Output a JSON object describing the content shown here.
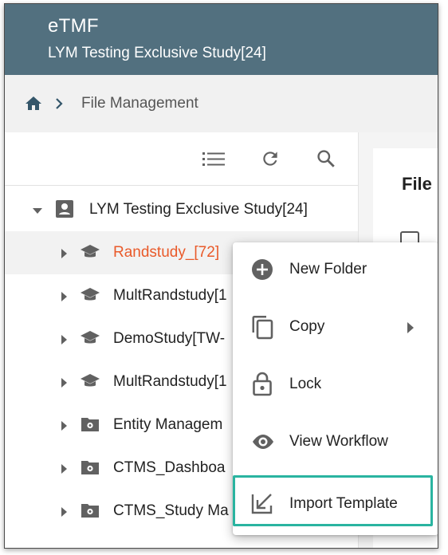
{
  "header": {
    "app_title": "eTMF",
    "study_name": "LYM Testing Exclusive Study[24]"
  },
  "breadcrumb": {
    "current": "File Management"
  },
  "tree": {
    "root": "LYM Testing Exclusive Study[24]",
    "items": [
      {
        "label": "Randstudy_[72]",
        "icon": "graduation-cap-icon",
        "state": "active"
      },
      {
        "label": "MultRandstudy[1",
        "icon": "graduation-cap-icon"
      },
      {
        "label": "DemoStudy[TW-",
        "icon": "graduation-cap-icon"
      },
      {
        "label": "MultRandstudy[1",
        "icon": "graduation-cap-icon"
      },
      {
        "label": "Entity Managem",
        "icon": "gear-folder-icon"
      },
      {
        "label": "CTMS_Dashboa",
        "icon": "gear-folder-icon"
      },
      {
        "label": "CTMS_Study Ma",
        "icon": "gear-folder-icon"
      }
    ]
  },
  "right_panel": {
    "heading": "File"
  },
  "context_menu": {
    "items": [
      {
        "label": "New Folder",
        "icon": "add-circle-icon"
      },
      {
        "label": "Copy",
        "icon": "copy-icon",
        "has_submenu": true
      },
      {
        "label": "Lock",
        "icon": "lock-icon"
      },
      {
        "label": "View Workflow",
        "icon": "eye-icon"
      },
      {
        "label": "Import Template",
        "icon": "import-icon",
        "highlighted": true
      }
    ]
  },
  "colors": {
    "header_bg": "#52707f",
    "active_text": "#e95a2a",
    "highlight_border": "#2ab4a0",
    "icon_gray": "#616161"
  }
}
